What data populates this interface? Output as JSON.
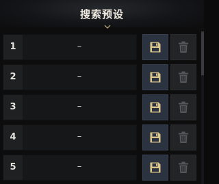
{
  "dialog": {
    "title": "搜索预设"
  },
  "presets": [
    {
      "number": "1",
      "name": "–"
    },
    {
      "number": "2",
      "name": "–"
    },
    {
      "number": "3",
      "name": "–"
    },
    {
      "number": "4",
      "name": "–"
    },
    {
      "number": "5",
      "name": "–"
    }
  ],
  "icons": {
    "save": "save-floppy-icon",
    "delete": "trash-icon"
  },
  "colors": {
    "title": "#f1ece2",
    "save_icon": "#d9c48a",
    "delete_icon": "#55565a",
    "save_button_bg": "#2c3340"
  }
}
